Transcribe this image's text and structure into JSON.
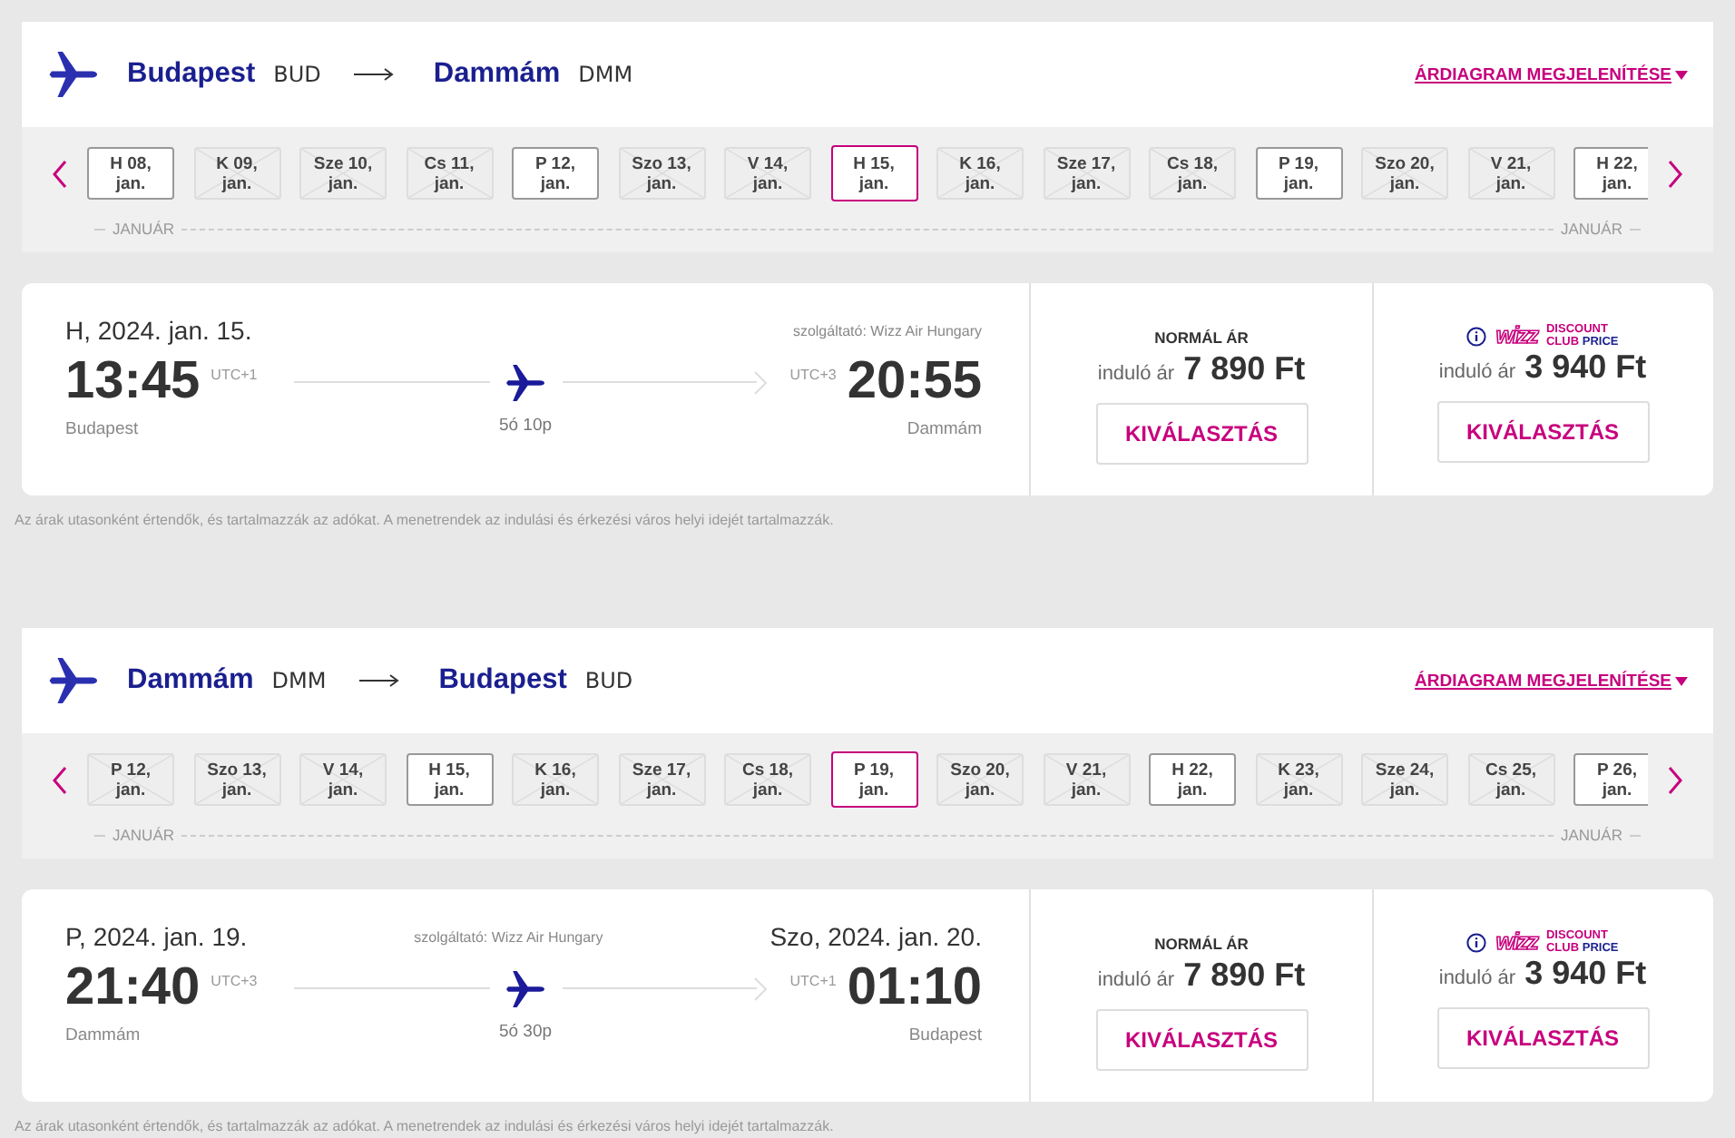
{
  "sections": [
    {
      "from_city": "Budapest",
      "from_code": "BUD",
      "to_city": "Dammám",
      "to_code": "DMM",
      "chart_link": "ÁRDIAGRAM MEGJELENÍTÉSE",
      "dates": [
        {
          "day": "H 08,",
          "month": "jan.",
          "kind": "available",
          "selected": false
        },
        {
          "day": "K 09,",
          "month": "jan.",
          "kind": "unavailable",
          "selected": false
        },
        {
          "day": "Sze 10,",
          "month": "jan.",
          "kind": "unavailable",
          "selected": false
        },
        {
          "day": "Cs 11,",
          "month": "jan.",
          "kind": "unavailable",
          "selected": false
        },
        {
          "day": "P 12,",
          "month": "jan.",
          "kind": "available",
          "selected": false
        },
        {
          "day": "Szo 13,",
          "month": "jan.",
          "kind": "unavailable",
          "selected": false
        },
        {
          "day": "V 14,",
          "month": "jan.",
          "kind": "unavailable",
          "selected": false
        },
        {
          "day": "H 15,",
          "month": "jan.",
          "kind": "available",
          "selected": true
        },
        {
          "day": "K 16,",
          "month": "jan.",
          "kind": "unavailable",
          "selected": false
        },
        {
          "day": "Sze 17,",
          "month": "jan.",
          "kind": "unavailable",
          "selected": false
        },
        {
          "day": "Cs 18,",
          "month": "jan.",
          "kind": "unavailable",
          "selected": false
        },
        {
          "day": "P 19,",
          "month": "jan.",
          "kind": "available",
          "selected": false
        },
        {
          "day": "Szo 20,",
          "month": "jan.",
          "kind": "unavailable",
          "selected": false
        },
        {
          "day": "V 21,",
          "month": "jan.",
          "kind": "unavailable",
          "selected": false
        },
        {
          "day": "H 22,",
          "month": "jan.",
          "kind": "available",
          "selected": false
        }
      ],
      "month_left": "JANUÁR",
      "month_right": "JANUÁR",
      "flight": {
        "dep_date": "H, 2024. jan. 15.",
        "operator": "szolgáltató: Wizz Air Hungary",
        "dep_time": "13:45",
        "dep_tz": "UTC+1",
        "arr_tz": "UTC+3",
        "arr_time": "20:55",
        "dep_city": "Budapest",
        "duration": "5ó 10p",
        "arr_city": "Dammám"
      },
      "normal": {
        "label": "NORMÁL ÁR",
        "prefix": "induló ár",
        "price": "7 890 Ft",
        "button": "KIVÁLASZTÁS"
      },
      "club": {
        "logo": "wizz",
        "line1": "DISCOUNT",
        "line2a": "CLUB",
        "line2b": "PRICE",
        "prefix": "induló ár",
        "price": "3 940 Ft",
        "button": "KIVÁLASZTÁS"
      },
      "note": "Az árak utasonként értendők, és tartalmazzák az adókat. A menetrendek az indulási és érkezési város helyi idejét tartalmazzák."
    },
    {
      "from_city": "Dammám",
      "from_code": "DMM",
      "to_city": "Budapest",
      "to_code": "BUD",
      "chart_link": "ÁRDIAGRAM MEGJELENÍTÉSE",
      "dates": [
        {
          "day": "P 12,",
          "month": "jan.",
          "kind": "unavailable",
          "selected": false
        },
        {
          "day": "Szo 13,",
          "month": "jan.",
          "kind": "unavailable",
          "selected": false
        },
        {
          "day": "V 14,",
          "month": "jan.",
          "kind": "unavailable",
          "selected": false
        },
        {
          "day": "H 15,",
          "month": "jan.",
          "kind": "available",
          "selected": false
        },
        {
          "day": "K 16,",
          "month": "jan.",
          "kind": "unavailable",
          "selected": false
        },
        {
          "day": "Sze 17,",
          "month": "jan.",
          "kind": "unavailable",
          "selected": false
        },
        {
          "day": "Cs 18,",
          "month": "jan.",
          "kind": "unavailable",
          "selected": false
        },
        {
          "day": "P 19,",
          "month": "jan.",
          "kind": "available",
          "selected": true
        },
        {
          "day": "Szo 20,",
          "month": "jan.",
          "kind": "unavailable",
          "selected": false
        },
        {
          "day": "V 21,",
          "month": "jan.",
          "kind": "unavailable",
          "selected": false
        },
        {
          "day": "H 22,",
          "month": "jan.",
          "kind": "available",
          "selected": false
        },
        {
          "day": "K 23,",
          "month": "jan.",
          "kind": "unavailable",
          "selected": false
        },
        {
          "day": "Sze 24,",
          "month": "jan.",
          "kind": "unavailable",
          "selected": false
        },
        {
          "day": "Cs 25,",
          "month": "jan.",
          "kind": "unavailable",
          "selected": false
        },
        {
          "day": "P 26,",
          "month": "jan.",
          "kind": "available",
          "selected": false
        }
      ],
      "month_left": "JANUÁR",
      "month_right": "JANUÁR",
      "flight": {
        "dep_date": "P, 2024. jan. 19.",
        "operator": "szolgáltató: Wizz Air Hungary",
        "arr_date": "Szo, 2024. jan. 20.",
        "dep_time": "21:40",
        "dep_tz": "UTC+3",
        "arr_tz": "UTC+1",
        "arr_time": "01:10",
        "dep_city": "Dammám",
        "duration": "5ó 30p",
        "arr_city": "Budapest"
      },
      "normal": {
        "label": "NORMÁL ÁR",
        "prefix": "induló ár",
        "price": "7 890 Ft",
        "button": "KIVÁLASZTÁS"
      },
      "club": {
        "logo": "wizz",
        "line1": "DISCOUNT",
        "line2a": "CLUB",
        "line2b": "PRICE",
        "prefix": "induló ár",
        "price": "3 940 Ft",
        "button": "KIVÁLASZTÁS"
      },
      "note": "Az árak utasonként értendők, és tartalmazzák az adókat. A menetrendek az indulási és érkezési város helyi idejét tartalmazzák."
    }
  ]
}
